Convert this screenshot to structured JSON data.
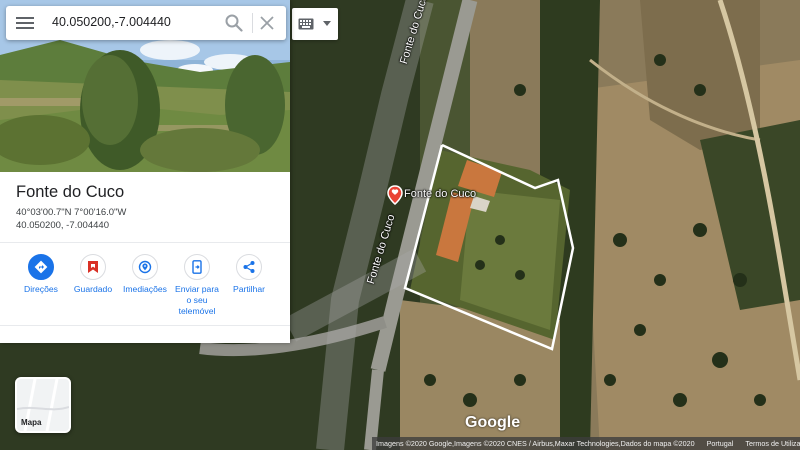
{
  "search": {
    "query": "40.050200,-7.004440"
  },
  "place": {
    "title": "Fonte do Cuco",
    "coords_dms": "40°03'00.7\"N 7°00'16.0\"W",
    "coords_decimal": "40.050200, -7.004440"
  },
  "actions": [
    {
      "label_lines": [
        "Direções"
      ],
      "icon": "directions-icon"
    },
    {
      "label_lines": [
        "Guardado"
      ],
      "icon": "bookmark-icon"
    },
    {
      "label_lines": [
        "Imediações"
      ],
      "icon": "nearby-icon"
    },
    {
      "label_lines": [
        "Enviar para",
        "o seu",
        "telemóvel"
      ],
      "icon": "send-to-phone-icon"
    },
    {
      "label_lines": [
        "Partilhar"
      ],
      "icon": "share-icon"
    }
  ],
  "map": {
    "pin_label": "Fonte do Cuco",
    "road_labels": [
      "Fonte do Cuco",
      "Fonte do Cuco"
    ],
    "layer_switch_label": "Mapa",
    "logo": "Google",
    "footer": {
      "attribution": "Imagens ©2020 Google,Imagens ©2020 CNES / Airbus,Maxar Technologies,Dados do mapa ©2020",
      "country": "Portugal",
      "terms": "Termos de Utilização"
    }
  },
  "colors": {
    "accent": "#1a73e8",
    "saved": "#d93025",
    "boundary": "#ffffff"
  }
}
